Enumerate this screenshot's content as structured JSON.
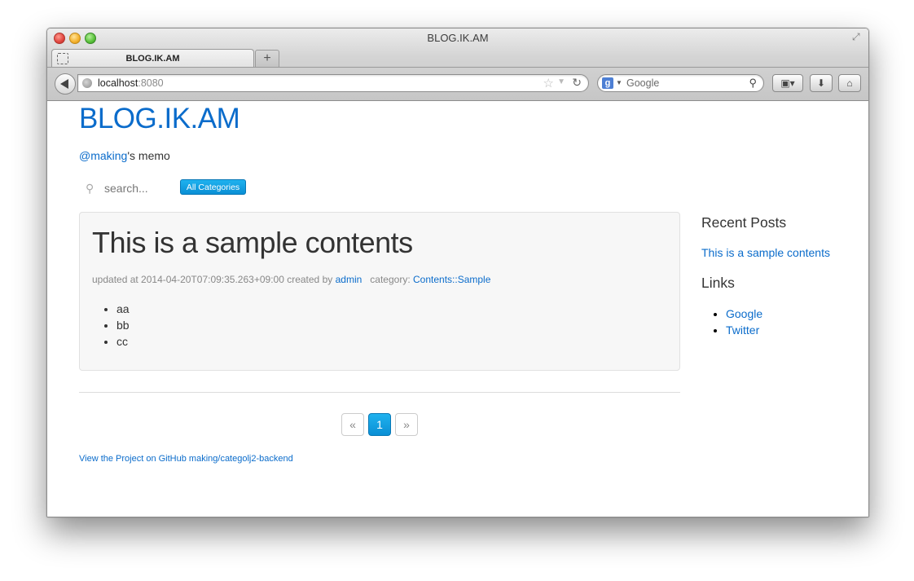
{
  "window": {
    "title": "BLOG.IK.AM"
  },
  "tab": {
    "title": "BLOG.IK.AM",
    "new_tab_label": "+"
  },
  "toolbar": {
    "url_host": "localhost",
    "url_port": ":8080",
    "search_engine_value": "Google"
  },
  "page": {
    "brand": "BLOG.IK.AM",
    "tagline_link": "@making",
    "tagline_rest": "'s memo",
    "search_placeholder": "search...",
    "category_button": "All Categories",
    "post": {
      "title": "This is a sample contents",
      "meta_prefix": "updated at 2014-04-20T07:09:35.263+09:00 created by",
      "author": "admin",
      "category_label": "category:",
      "category": "Contents::Sample",
      "items": [
        "aa",
        "bb",
        "cc"
      ]
    },
    "pagination": {
      "prev": "«",
      "current": "1",
      "next": "»"
    },
    "footer": "View the Project on GitHub making/categolj2-backend",
    "sidebar": {
      "recent_heading": "Recent Posts",
      "recent_posts": [
        "This is a sample contents"
      ],
      "links_heading": "Links",
      "links": [
        "Google",
        "Twitter"
      ]
    }
  },
  "colors": {
    "link": "#0b6ccb",
    "accent": "#0a8fd5"
  }
}
